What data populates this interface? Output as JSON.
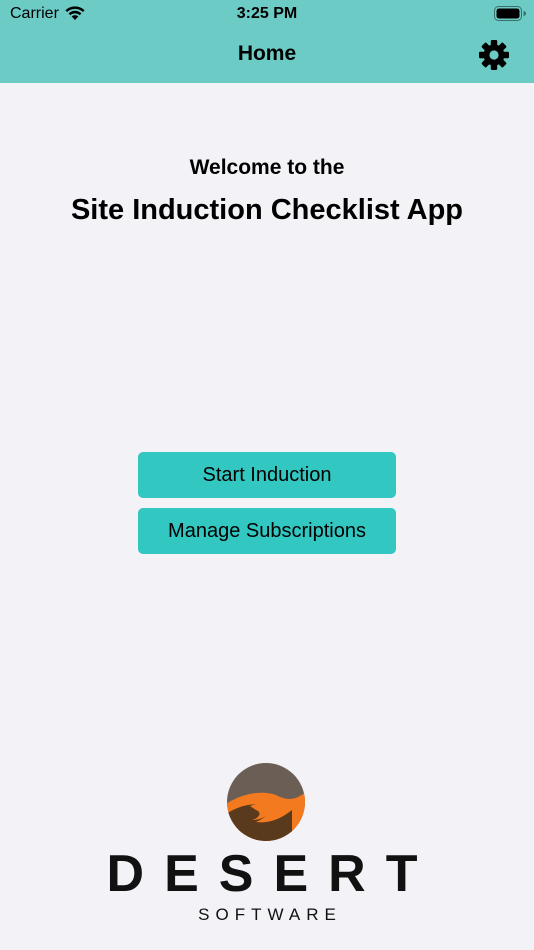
{
  "status_bar": {
    "carrier": "Carrier",
    "time": "3:25 PM",
    "wifi_icon": "wifi-icon",
    "battery_icon": "battery-icon"
  },
  "nav": {
    "title": "Home",
    "settings_icon": "gear-icon"
  },
  "main": {
    "welcome": "Welcome to the",
    "app_title": "Site Induction Checklist App"
  },
  "buttons": {
    "start": "Start Induction",
    "manage": "Manage Subscriptions"
  },
  "logo": {
    "word": "DESERT",
    "sub": "SOFTWARE"
  },
  "colors": {
    "header": "#6ccbc5",
    "button": "#33c7c1",
    "background": "#f2f2f7",
    "logo_brown": "#6b5f55",
    "logo_orange": "#f47a20",
    "logo_dark": "#5a3a1c"
  }
}
